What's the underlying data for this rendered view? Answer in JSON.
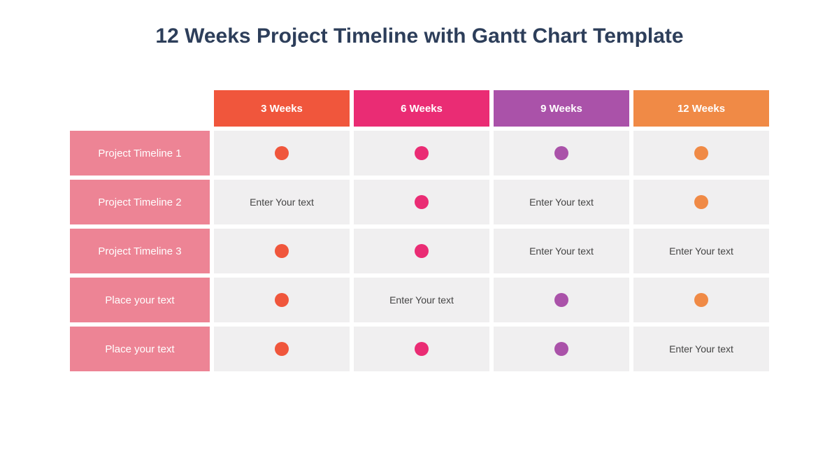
{
  "title": "12 Weeks Project Timeline with Gantt Chart Template",
  "columns": [
    {
      "label": "3 Weeks",
      "color": "#f0563c",
      "dot": "#f0563c"
    },
    {
      "label": "6 Weeks",
      "color": "#ea2c74",
      "dot": "#ea2c74"
    },
    {
      "label": "9 Weeks",
      "color": "#aa52a9",
      "dot": "#aa52a9"
    },
    {
      "label": "12 Weeks",
      "color": "#f08a46",
      "dot": "#f08a46"
    }
  ],
  "placeholder": "Enter Your text",
  "rows": [
    {
      "label": "Project Timeline 1",
      "cells": [
        {
          "type": "dot",
          "col": 0
        },
        {
          "type": "dot",
          "col": 1
        },
        {
          "type": "dot",
          "col": 2
        },
        {
          "type": "dot",
          "col": 3
        }
      ]
    },
    {
      "label": "Project Timeline 2",
      "cells": [
        {
          "type": "text"
        },
        {
          "type": "dot",
          "col": 1
        },
        {
          "type": "text"
        },
        {
          "type": "dot",
          "col": 3
        }
      ]
    },
    {
      "label": "Project Timeline 3",
      "cells": [
        {
          "type": "dot",
          "col": 0
        },
        {
          "type": "dot",
          "col": 1
        },
        {
          "type": "text"
        },
        {
          "type": "text"
        }
      ]
    },
    {
      "label": "Place your text",
      "cells": [
        {
          "type": "dot",
          "col": 0
        },
        {
          "type": "text"
        },
        {
          "type": "dot",
          "col": 2
        },
        {
          "type": "dot",
          "col": 3
        }
      ]
    },
    {
      "label": "Place your text",
      "cells": [
        {
          "type": "dot",
          "col": 0
        },
        {
          "type": "dot",
          "col": 1
        },
        {
          "type": "dot",
          "col": 2
        },
        {
          "type": "text"
        }
      ]
    }
  ]
}
